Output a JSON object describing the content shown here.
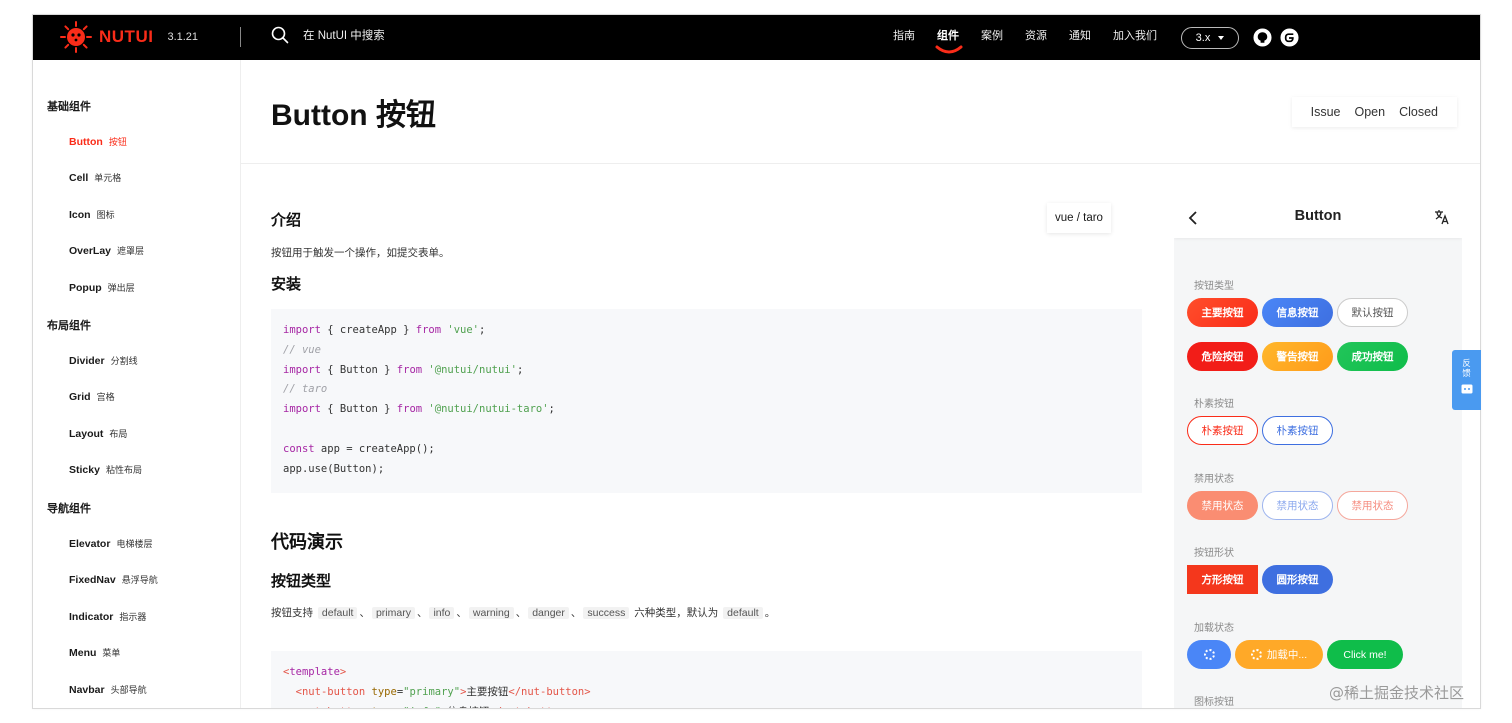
{
  "header": {
    "brand": "NUTUI",
    "version": "3.1.21",
    "search_placeholder": "在 NutUI 中搜索",
    "nav": [
      "指南",
      "组件",
      "案例",
      "资源",
      "通知",
      "加入我们"
    ],
    "active_nav": "组件",
    "version_select": "3.x",
    "accent_color": "#fa2c19"
  },
  "sidebar": {
    "groups": [
      {
        "label": "基础组件",
        "items": [
          {
            "en": "Button",
            "cn": "按钮"
          },
          {
            "en": "Cell",
            "cn": "单元格"
          },
          {
            "en": "Icon",
            "cn": "图标"
          },
          {
            "en": "OverLay",
            "cn": "遮罩层"
          },
          {
            "en": "Popup",
            "cn": "弹出层"
          }
        ]
      },
      {
        "label": "布局组件",
        "items": [
          {
            "en": "Divider",
            "cn": "分割线"
          },
          {
            "en": "Grid",
            "cn": "宫格"
          },
          {
            "en": "Layout",
            "cn": "布局"
          },
          {
            "en": "Sticky",
            "cn": "粘性布局"
          }
        ]
      },
      {
        "label": "导航组件",
        "items": [
          {
            "en": "Elevator",
            "cn": "电梯楼层"
          },
          {
            "en": "FixedNav",
            "cn": "悬浮导航"
          },
          {
            "en": "Indicator",
            "cn": "指示器"
          },
          {
            "en": "Menu",
            "cn": "菜单"
          },
          {
            "en": "Navbar",
            "cn": "头部导航"
          }
        ]
      }
    ]
  },
  "page": {
    "title": "Button 按钮",
    "issue_links": [
      "Issue",
      "Open",
      "Closed"
    ]
  },
  "content": {
    "intro_heading": "介绍",
    "intro_text": "按钮用于触发一个操作，如提交表单。",
    "platform_toggle": "vue / taro",
    "install_heading": "安装",
    "install_code": [
      "import { createApp } from 'vue';",
      "// vue",
      "import { Button } from '@nutui/nutui';",
      "// taro",
      "import { Button } from '@nutui/nutui-taro';",
      "",
      "const app = createApp();",
      "app.use(Button);"
    ],
    "demo_heading": "代码演示",
    "type_heading": "按钮类型",
    "type_text_prefix": "按钮支持",
    "type_codes": [
      "default",
      "primary",
      "info",
      "warning",
      "danger",
      "success"
    ],
    "type_text_mid": "六种类型，默认为",
    "type_default": "default",
    "type_text_end": "。",
    "template_code": [
      "<template>",
      "  <nut-button type=\"primary\">主要按钮</nut-button>",
      "  <nut-button type=\"info\">信息按钮</nut-button>"
    ]
  },
  "preview": {
    "title": "Button",
    "sections": [
      {
        "label": "按钮类型",
        "rows": [
          [
            "主要按钮",
            "信息按钮",
            "默认按钮"
          ],
          [
            "危险按钮",
            "警告按钮",
            "成功按钮"
          ]
        ]
      },
      {
        "label": "朴素按钮",
        "rows": [
          [
            "朴素按钮",
            "朴素按钮"
          ]
        ]
      },
      {
        "label": "禁用状态",
        "rows": [
          [
            "禁用状态",
            "禁用状态",
            "禁用状态"
          ]
        ]
      },
      {
        "label": "按钮形状",
        "rows": [
          [
            "方形按钮",
            "圆形按钮"
          ]
        ]
      },
      {
        "label": "加载状态",
        "rows": [
          [
            "",
            "加载中...",
            "Click me!"
          ]
        ]
      },
      {
        "label": "图标按钮",
        "rows": []
      }
    ]
  },
  "feedback": [
    "反",
    "馈"
  ],
  "watermark": "@稀土掘金技术社区"
}
